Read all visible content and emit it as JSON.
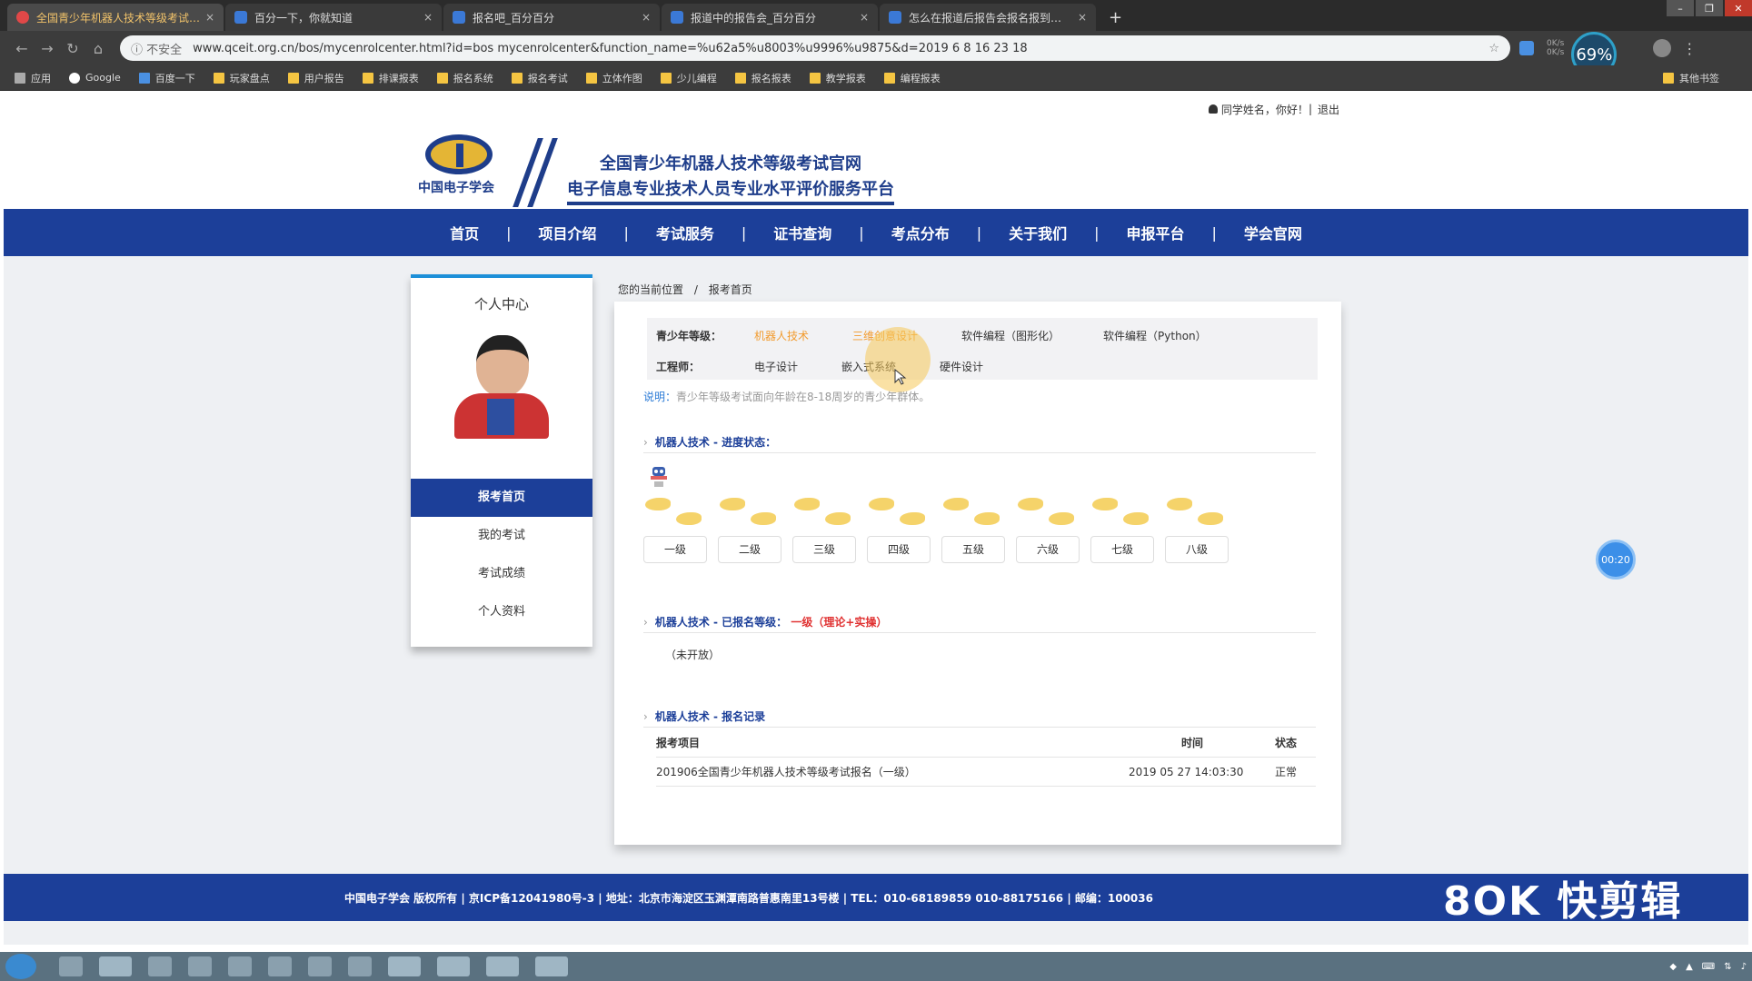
{
  "browser": {
    "tabs": [
      {
        "title": "全国青少年机器人技术等级考试…",
        "active": true
      },
      {
        "title": "百分一下，你就知道",
        "active": false
      },
      {
        "title": "报名吧_百分百分",
        "active": false
      },
      {
        "title": "报道中的报告会_百分百分",
        "active": false
      },
      {
        "title": "怎么在报道后报告会报名报到…",
        "active": false
      }
    ],
    "new_tab": "+",
    "address": {
      "security_label": "不安全",
      "url": "www.qceit.org.cn/bos/mycenrolcenter.html?id=bos mycenrolcenter&function_name=%u62a5%u8003%u9996%u9875&d=2019 6 8 16 23 18"
    },
    "speed": {
      "up": "0K/s",
      "down": "0K/s"
    },
    "battery": "69%",
    "bookmarks": [
      "应用",
      "Google",
      "百度一下",
      "玩家盘点",
      "用户报告",
      "排课报表",
      "报名系统",
      "报名考试",
      "立体作图",
      "少儿编程",
      "报名报表",
      "教学报表",
      "编程报表"
    ],
    "bookmarks_right": "其他书签"
  },
  "site": {
    "topbar": {
      "greeting": "同学姓名，你好！",
      "logout": "退出"
    },
    "logo_text": "中国电子学会",
    "title1": "全国青少年机器人技术等级考试官网",
    "title2": "电子信息专业技术人员专业水平评价服务平台",
    "nav": [
      "首页",
      "项目介绍",
      "考试服务",
      "证书查询",
      "考点分布",
      "关于我们",
      "申报平台",
      "学会官网"
    ]
  },
  "sidebar": {
    "title": "个人中心",
    "menu": [
      "报考首页",
      "我的考试",
      "考试成绩",
      "个人资料"
    ]
  },
  "breadcrumb": {
    "root": "您的当前位置",
    "sep": "/",
    "current": "报考首页"
  },
  "filter": {
    "row1_label": "青少年等级：",
    "row1_options": [
      "机器人技术",
      "三维创意设计",
      "软件编程（图形化）",
      "软件编程（Python）"
    ],
    "row2_label": "工程师：",
    "row2_options": [
      "电子设计",
      "嵌入式系统",
      "硬件设计"
    ],
    "note_label": "说明：",
    "note": "青少年等级考试面向年龄在8-18周岁的青少年群体。"
  },
  "sections": {
    "progress_title": "机器人技术 - 进度状态：",
    "registered_title": "机器人技术 - 已报名等级：",
    "registered_value": "一级（理论+实操）",
    "exam_type": "（未开放）",
    "records_title": "机器人技术 - 报名记录"
  },
  "levels": [
    "一级",
    "二级",
    "三级",
    "四级",
    "五级",
    "六级",
    "七级",
    "八级"
  ],
  "records": {
    "headers": [
      "报考项目",
      "时间",
      "状态"
    ],
    "rows": [
      {
        "item": "201906全国青少年机器人技术等级考试报名（一级）",
        "time": "2019 05 27 14:03:30",
        "status": "正常"
      }
    ]
  },
  "timer": "00:20",
  "footer": "中国电子学会 版权所有 | 京ICP备12041980号-3 | 地址：北京市海淀区玉渊潭南路普惠南里13号楼 | TEL：010-68189859 010-88175166 | 邮编：100036",
  "watermark": "8OK 快剪辑",
  "colors": {
    "nav_blue": "#1c3f99",
    "accent_orange": "#f29b2e",
    "link_blue": "#2a7ad6",
    "sidebar_top": "#1c8fd8"
  }
}
